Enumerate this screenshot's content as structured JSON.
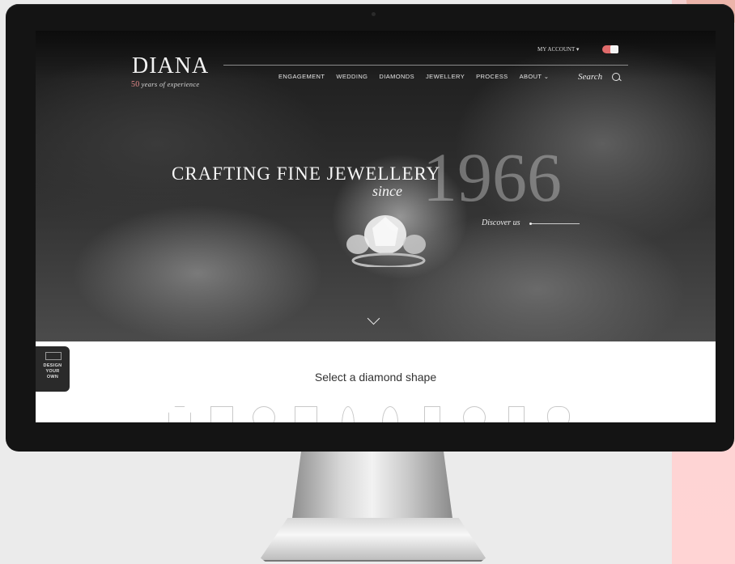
{
  "site": {
    "logo": "DIANA",
    "tagline_number": "50",
    "tagline_text": "years of experience",
    "account_label": "MY ACCOUNT ▾"
  },
  "nav": {
    "items": [
      {
        "label": "ENGAGEMENT"
      },
      {
        "label": "WEDDING"
      },
      {
        "label": "DIAMONDS"
      },
      {
        "label": "JEWELLERY"
      },
      {
        "label": "PROCESS"
      },
      {
        "label": "ABOUT ⌄"
      }
    ],
    "search_label": "Search"
  },
  "hero": {
    "headline": "CRAFTING FINE JEWELLERY",
    "since": "since",
    "year": "1966",
    "discover": "Discover us"
  },
  "shapes": {
    "title": "Select a diamond shape",
    "items": [
      {
        "icon": "round-diamond-icon"
      },
      {
        "icon": "princess-diamond-icon"
      },
      {
        "icon": "cushion-diamond-icon"
      },
      {
        "icon": "emerald-diamond-icon"
      },
      {
        "icon": "marquise-diamond-icon"
      },
      {
        "icon": "pear-diamond-icon"
      },
      {
        "icon": "radiant-diamond-icon"
      },
      {
        "icon": "oval-diamond-icon"
      },
      {
        "icon": "asscher-diamond-icon"
      },
      {
        "icon": "heart-diamond-icon"
      }
    ]
  },
  "design_own": {
    "line1": "DESIGN",
    "line2": "YOUR",
    "line3": "OWN"
  },
  "colors": {
    "accent_pink": "#ffd4d4",
    "bezel": "#141414",
    "tagline_accent": "#e58a8a"
  }
}
